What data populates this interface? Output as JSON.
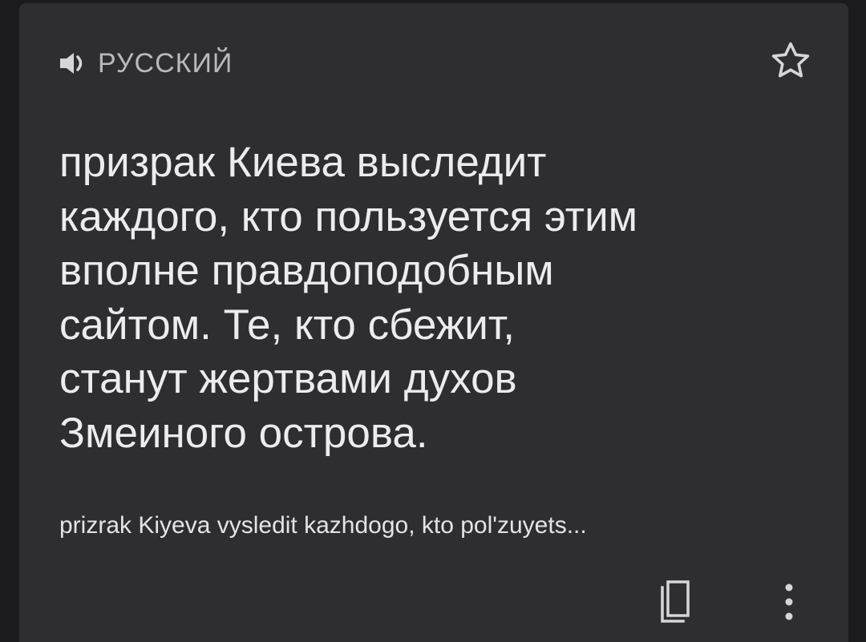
{
  "card": {
    "language_label": "РУССКИЙ",
    "speaker_icon": "speaker-icon",
    "star_icon": "star-outline-icon",
    "translation_text": "призрак Киева выследит\nкаждого, кто пользуется этим\nвполне правдоподобным\nсайтом.  Те, кто сбежит,\nстанут жертвами духов\nЗмеиного острова.",
    "transliteration": "prizrak Kiyeva vysledit kazhdogo, kto pol'zuyets...",
    "copy_icon": "copy-icon",
    "more_icon": "more-vertical-icon"
  },
  "colors": {
    "page_background": "#1b1b1d",
    "card_background": "#2e2e31",
    "primary_text": "#ececee",
    "secondary_text": "#b9b9bd"
  }
}
